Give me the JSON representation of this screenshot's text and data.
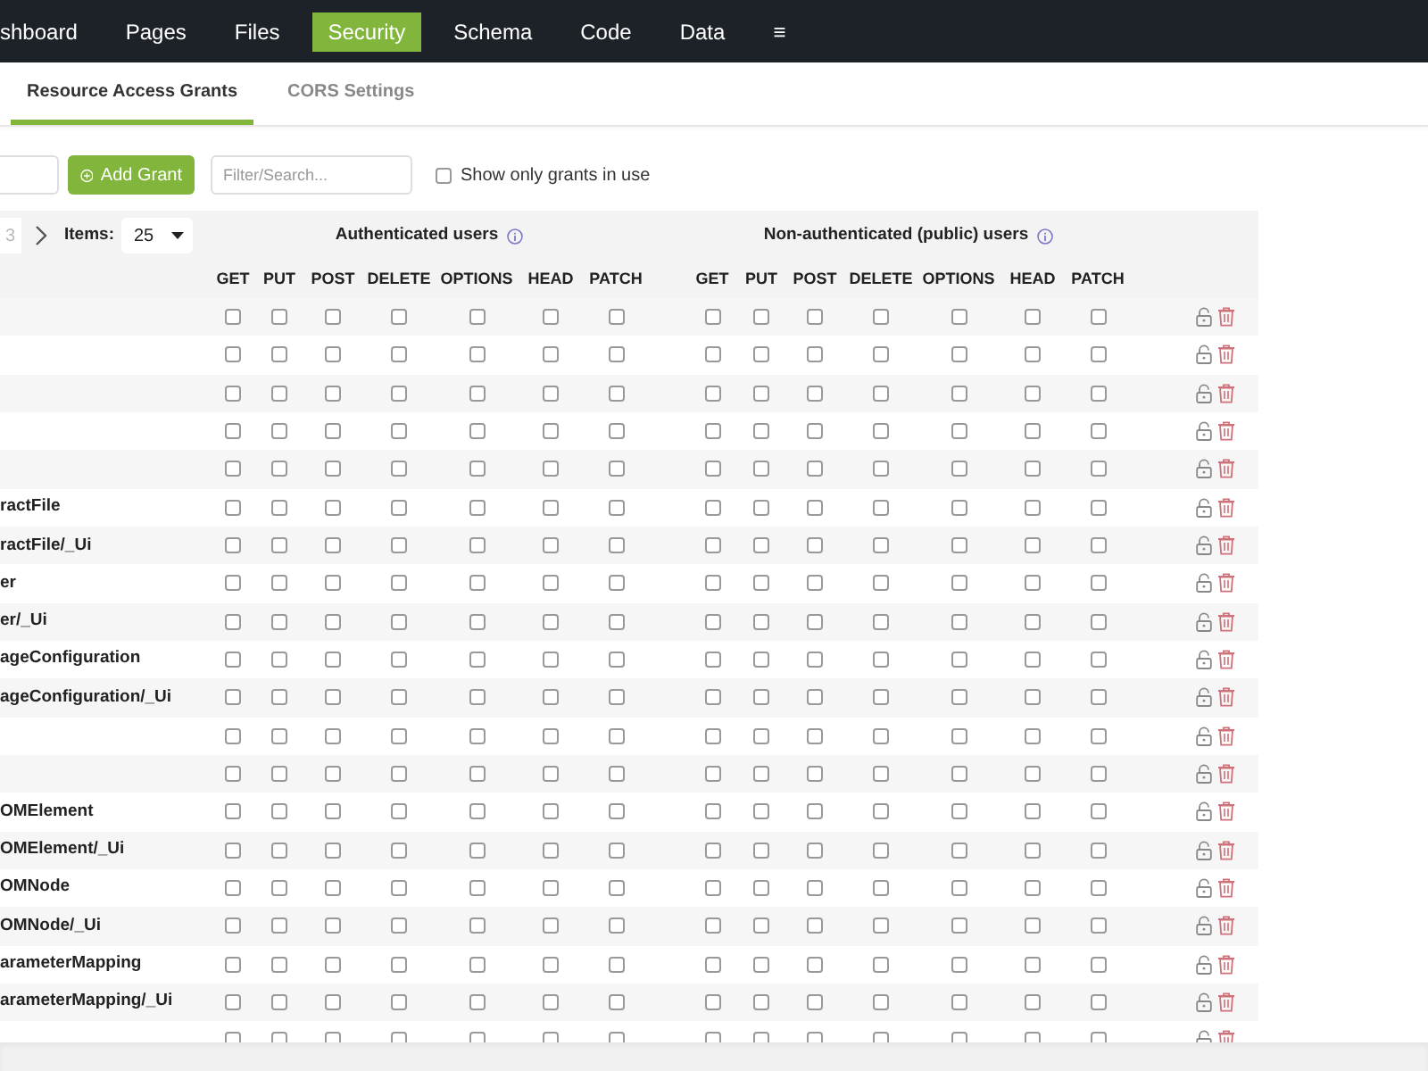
{
  "nav": [
    {
      "label": "shboard",
      "selected": false
    },
    {
      "label": "Pages",
      "selected": false
    },
    {
      "label": "Files",
      "selected": false
    },
    {
      "label": "Security",
      "selected": true
    },
    {
      "label": "Schema",
      "selected": false
    },
    {
      "label": "Code",
      "selected": false
    },
    {
      "label": "Data",
      "selected": false
    },
    {
      "label": "≡",
      "selected": false
    }
  ],
  "subtabs": [
    {
      "label": "Resource Access Grants",
      "selected": true
    },
    {
      "label": "CORS Settings",
      "selected": false
    }
  ],
  "toolbar": {
    "add_button": "Add Grant",
    "search": {
      "placeholder": "Filter/Search..."
    },
    "in_use_filter": {
      "label": "Show only grants in use",
      "checked": false
    }
  },
  "pagination": {
    "page": "3",
    "items_label": "Items:",
    "page_size": "25"
  },
  "groups": [
    {
      "title": "Authenticated users",
      "methods": [
        "GET",
        "PUT",
        "POST",
        "DELETE",
        "OPTIONS",
        "HEAD",
        "PATCH"
      ]
    },
    {
      "title": "Non-authenticated (public) users",
      "methods": [
        "GET",
        "PUT",
        "POST",
        "DELETE",
        "OPTIONS",
        "HEAD",
        "PATCH"
      ]
    }
  ],
  "rows": [
    {
      "authenticated": [
        false,
        false,
        false,
        false,
        false,
        false,
        false
      ],
      "public": [
        false,
        false,
        false,
        false,
        false,
        false,
        false
      ]
    },
    {
      "authenticated": [
        false,
        false,
        false,
        false,
        false,
        false,
        false
      ],
      "public": [
        false,
        false,
        false,
        false,
        false,
        false,
        false
      ]
    },
    {
      "authenticated": [
        false,
        false,
        false,
        false,
        false,
        false,
        false
      ],
      "public": [
        false,
        false,
        false,
        false,
        false,
        false,
        false
      ]
    },
    {
      "authenticated": [
        false,
        false,
        false,
        false,
        false,
        false,
        false
      ],
      "public": [
        false,
        false,
        false,
        false,
        false,
        false,
        false
      ]
    },
    {
      "authenticated": [
        false,
        false,
        false,
        false,
        false,
        false,
        false
      ],
      "public": [
        false,
        false,
        false,
        false,
        false,
        false,
        false
      ]
    },
    {
      "label": "ractFile",
      "authenticated": [
        false,
        false,
        false,
        false,
        false,
        false,
        false
      ],
      "public": [
        false,
        false,
        false,
        false,
        false,
        false,
        false
      ]
    },
    {
      "label": "ractFile/_Ui",
      "authenticated": [
        false,
        false,
        false,
        false,
        false,
        false,
        false
      ],
      "public": [
        false,
        false,
        false,
        false,
        false,
        false,
        false
      ]
    },
    {
      "label": "er",
      "authenticated": [
        false,
        false,
        false,
        false,
        false,
        false,
        false
      ],
      "public": [
        false,
        false,
        false,
        false,
        false,
        false,
        false
      ]
    },
    {
      "label": "er/_Ui",
      "authenticated": [
        false,
        false,
        false,
        false,
        false,
        false,
        false
      ],
      "public": [
        false,
        false,
        false,
        false,
        false,
        false,
        false
      ]
    },
    {
      "label": "ageConfiguration",
      "authenticated": [
        false,
        false,
        false,
        false,
        false,
        false,
        false
      ],
      "public": [
        false,
        false,
        false,
        false,
        false,
        false,
        false
      ]
    },
    {
      "label": "ageConfiguration/_Ui",
      "authenticated": [
        false,
        false,
        false,
        false,
        false,
        false,
        false
      ],
      "public": [
        false,
        false,
        false,
        false,
        false,
        false,
        false
      ]
    },
    {
      "authenticated": [
        false,
        false,
        false,
        false,
        false,
        false,
        false
      ],
      "public": [
        false,
        false,
        false,
        false,
        false,
        false,
        false
      ]
    },
    {
      "authenticated": [
        false,
        false,
        false,
        false,
        false,
        false,
        false
      ],
      "public": [
        false,
        false,
        false,
        false,
        false,
        false,
        false
      ]
    },
    {
      "label": "OMElement",
      "authenticated": [
        false,
        false,
        false,
        false,
        false,
        false,
        false
      ],
      "public": [
        false,
        false,
        false,
        false,
        false,
        false,
        false
      ]
    },
    {
      "label": "OMElement/_Ui",
      "authenticated": [
        false,
        false,
        false,
        false,
        false,
        false,
        false
      ],
      "public": [
        false,
        false,
        false,
        false,
        false,
        false,
        false
      ]
    },
    {
      "label": "OMNode",
      "authenticated": [
        false,
        false,
        false,
        false,
        false,
        false,
        false
      ],
      "public": [
        false,
        false,
        false,
        false,
        false,
        false,
        false
      ]
    },
    {
      "label": "OMNode/_Ui",
      "authenticated": [
        false,
        false,
        false,
        false,
        false,
        false,
        false
      ],
      "public": [
        false,
        false,
        false,
        false,
        false,
        false,
        false
      ]
    },
    {
      "label": "arameterMapping",
      "authenticated": [
        false,
        false,
        false,
        false,
        false,
        false,
        false
      ],
      "public": [
        false,
        false,
        false,
        false,
        false,
        false,
        false
      ]
    },
    {
      "label": "arameterMapping/_Ui",
      "authenticated": [
        false,
        false,
        false,
        false,
        false,
        false,
        false
      ],
      "public": [
        false,
        false,
        false,
        false,
        false,
        false,
        false
      ]
    },
    {
      "authenticated": [
        false,
        false,
        false,
        false,
        false,
        false,
        false
      ],
      "public": [
        false,
        false,
        false,
        false,
        false,
        false,
        false
      ]
    }
  ]
}
